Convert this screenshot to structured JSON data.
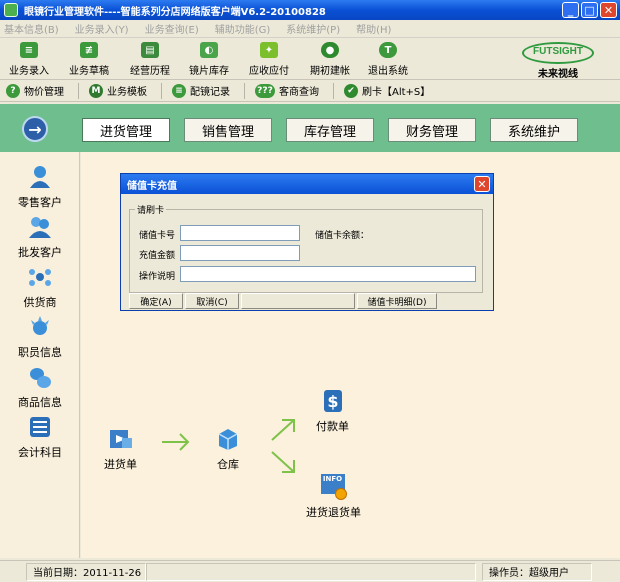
{
  "window": {
    "title": "眼镜行业管理软件----智能系列分店网络版客户端V6.2-20100828",
    "minimize_glyph": "_",
    "maximize_glyph": "□",
    "close_glyph": "✕"
  },
  "menu": [
    "基本信息(B)",
    "业务录入(Y)",
    "业务查询(E)",
    "辅助功能(G)",
    "系统维护(P)",
    "帮助(H)"
  ],
  "toolbar": {
    "items": [
      {
        "label": "业务录入",
        "icon": "business-entry-icon"
      },
      {
        "label": "业务草稿",
        "icon": "business-draft-icon"
      },
      {
        "label": "经营历程",
        "icon": "history-icon"
      },
      {
        "label": "镜片库存",
        "icon": "lens-stock-icon"
      },
      {
        "label": "应收应付",
        "icon": "receivable-icon"
      },
      {
        "label": "期初建帐",
        "icon": "opening-account-icon"
      },
      {
        "label": "退出系统",
        "icon": "exit-icon"
      }
    ],
    "logo_text": "FUTSIGHT",
    "logo_sub": "未来视线"
  },
  "toolbar2": {
    "items": [
      {
        "label": "物价管理",
        "glyph": "?"
      },
      {
        "label": "业务模板",
        "glyph": "M"
      },
      {
        "label": "配镜记录",
        "glyph": "≡"
      },
      {
        "label": "客商查询",
        "glyph": "???"
      },
      {
        "label": "刷卡【Alt+S】",
        "glyph": "✔"
      }
    ]
  },
  "nav": {
    "tabs": [
      "进货管理",
      "销售管理",
      "库存管理",
      "财务管理",
      "系统维护"
    ],
    "active": "进货管理",
    "arrow_glyph": "→"
  },
  "sidebar": {
    "items": [
      {
        "label": "零售客户",
        "icon": "retail-customer-icon"
      },
      {
        "label": "批发客户",
        "icon": "wholesale-customer-icon"
      },
      {
        "label": "供货商",
        "icon": "supplier-icon"
      },
      {
        "label": "职员信息",
        "icon": "staff-icon"
      },
      {
        "label": "商品信息",
        "icon": "goods-icon"
      },
      {
        "label": "会计科目",
        "icon": "account-subject-icon"
      }
    ]
  },
  "dialog": {
    "title": "储值卡充值",
    "group_label": "请刷卡",
    "card_no_label": "储值卡号",
    "card_no_value": "",
    "balance_label": "储值卡余额：",
    "amount_label": "充值金额",
    "amount_value": "",
    "note_label": "操作说明",
    "note_value": "",
    "ok_label": "确定(A)",
    "cancel_label": "取消(C)",
    "detail_label": "储值卡明细(D)",
    "close_glyph": "✕"
  },
  "flow": {
    "purchase_label": "进货单",
    "warehouse_label": "仓库",
    "payment_label": "付款单",
    "return_label": "进货退货单",
    "info_badge": "INFO"
  },
  "status": {
    "date_label": "当前日期：2011-11-26",
    "operator_label": "操作员：超级用户"
  },
  "colors": {
    "accent": "#6fbf8e",
    "title_blue": "#0a51d6",
    "content_bg": "#fbf1dc",
    "flow_arrow": "#7ec24a"
  }
}
